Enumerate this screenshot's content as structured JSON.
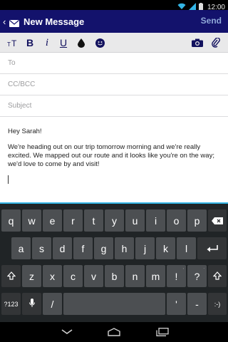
{
  "status_bar": {
    "time": "12:00",
    "icons": [
      "wifi-icon",
      "signal-icon",
      "battery-icon"
    ]
  },
  "action_bar": {
    "title": "New Message",
    "send_label": "Send",
    "colors": {
      "background": "#13126c",
      "send": "#8fa8d8"
    }
  },
  "format_toolbar": {
    "items": [
      "text-size-icon",
      "bold-icon",
      "italic-icon",
      "underline-icon",
      "text-color-icon",
      "emoji-icon",
      "camera-icon",
      "attachment-icon"
    ],
    "bold_label": "B",
    "italic_label": "i",
    "underline_label": "U"
  },
  "compose": {
    "to_placeholder": "To",
    "ccbcc_placeholder": "CC/BCC",
    "subject_placeholder": "Subject",
    "greeting": "Hey Sarah!",
    "message": "We're heading out on our trip tomorrow morning and we're really excited. We mapped out our route and it looks like you're on the way; we'd love to come by and visit!"
  },
  "keyboard": {
    "row1": [
      "q",
      "w",
      "e",
      "r",
      "t",
      "y",
      "u",
      "i",
      "o",
      "p"
    ],
    "row2": [
      "a",
      "s",
      "d",
      "f",
      "g",
      "h",
      "j",
      "k",
      "l"
    ],
    "row3": [
      "z",
      "x",
      "c",
      "v",
      "b",
      "n",
      "m",
      "!",
      "?"
    ],
    "row3_hints": [
      "",
      "",
      "",
      "",
      "",
      "",
      "",
      ",",
      "."
    ],
    "symbols_label": "?123",
    "slash_label": "/",
    "apostrophe_label": "'",
    "dash_label": "-",
    "colon_label": ":-)",
    "accent_color": "#33b5e5"
  },
  "nav_bar": {
    "icons": [
      "back-icon",
      "home-icon",
      "recents-icon"
    ]
  }
}
